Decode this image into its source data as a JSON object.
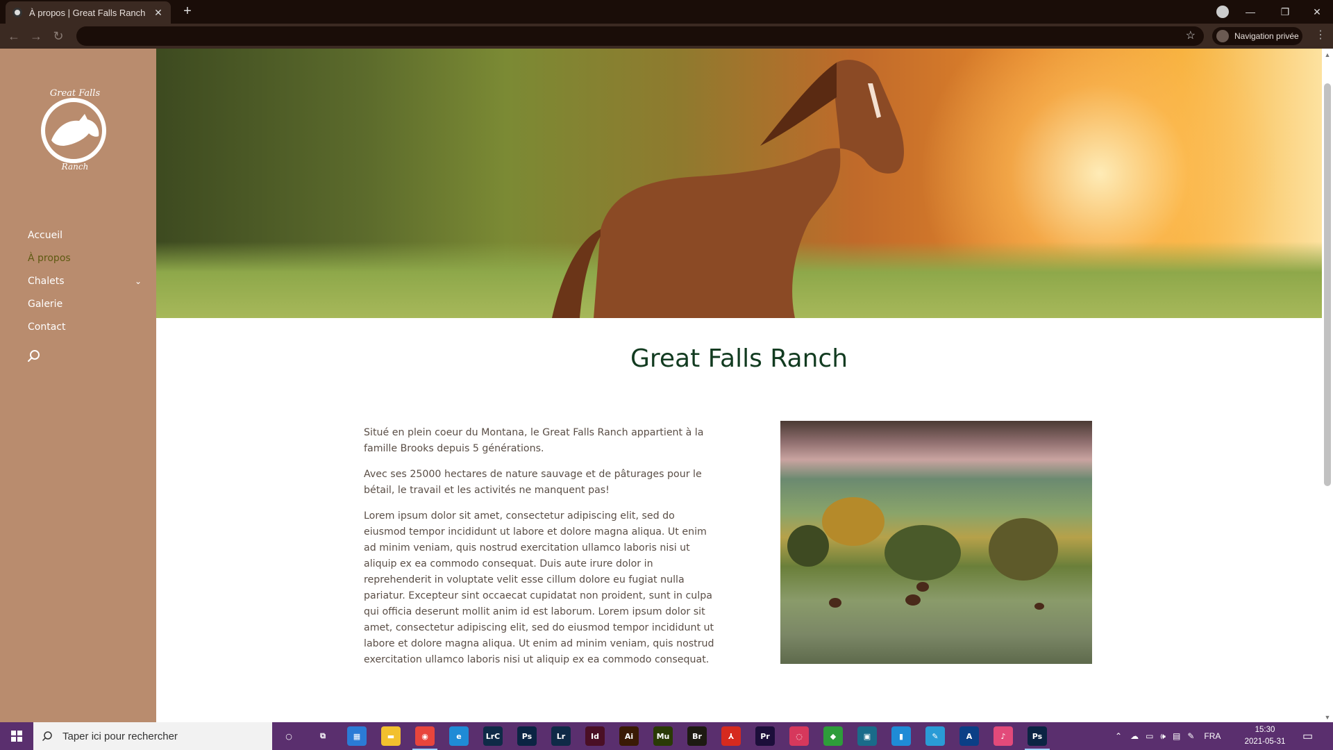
{
  "browser": {
    "tab_title": "À propos | Great Falls Ranch",
    "close_tab": "✕",
    "new_tab": "+",
    "incognito_label": "Navigation privée",
    "address": ""
  },
  "sidebar": {
    "logo_alt": "Great Falls Ranch",
    "logo_top_text": "Great Falls",
    "logo_bottom_text": "Ranch",
    "items": [
      {
        "label": "Accueil",
        "active": false
      },
      {
        "label": "À propos",
        "active": true
      },
      {
        "label": "Chalets",
        "active": false,
        "has_submenu": true
      },
      {
        "label": "Galerie",
        "active": false
      },
      {
        "label": "Contact",
        "active": false
      }
    ]
  },
  "main": {
    "title": "Great Falls Ranch",
    "paragraphs": [
      "Situé en plein coeur du Montana, le Great Falls Ranch appartient à la famille Brooks depuis 5 générations.",
      "Avec ses 25000 hectares de nature sauvage et de pâturages pour le bétail, le travail et les activités ne manquent pas!",
      "Lorem ipsum dolor sit amet, consectetur adipiscing elit, sed do eiusmod tempor incididunt ut labore et dolore magna aliqua. Ut enim ad minim veniam, quis nostrud exercitation ullamco laboris nisi ut aliquip ex ea commodo consequat. Duis aute irure dolor in reprehenderit in voluptate velit esse cillum dolore eu fugiat nulla pariatur. Excepteur sint occaecat cupidatat non proident, sunt in culpa qui officia deserunt mollit anim id est laborum. Lorem ipsum dolor sit amet, consectetur adipiscing elit, sed do eiusmod tempor incididunt ut labore et dolore magna aliqua. Ut enim ad minim veniam, quis nostrud exercitation ullamco laboris nisi ut aliquip ex ea commodo consequat."
    ]
  },
  "taskbar": {
    "search_placeholder": "Taper ici pour rechercher",
    "apps": [
      {
        "name": "cortana-icon",
        "label": "○",
        "color": "transparent"
      },
      {
        "name": "task-view-icon",
        "label": "⧉",
        "color": "transparent"
      },
      {
        "name": "store-icon",
        "label": "▦",
        "color": "#2b7bd6"
      },
      {
        "name": "file-explorer-icon",
        "label": "▬",
        "color": "#f2c02e"
      },
      {
        "name": "chrome-icon",
        "label": "◉",
        "color": "#e8453c"
      },
      {
        "name": "edge-icon",
        "label": "e",
        "color": "#1f8bd6"
      },
      {
        "name": "lightroom-classic-icon",
        "label": "LrC",
        "color": "#0f2a47"
      },
      {
        "name": "photoshop-icon",
        "label": "Ps",
        "color": "#0b2443"
      },
      {
        "name": "lightroom-icon",
        "label": "Lr",
        "color": "#0f2a47"
      },
      {
        "name": "indesign-icon",
        "label": "Id",
        "color": "#4a0f25"
      },
      {
        "name": "illustrator-icon",
        "label": "Ai",
        "color": "#3a1a05"
      },
      {
        "name": "muse-icon",
        "label": "Mu",
        "color": "#2a3a06"
      },
      {
        "name": "bridge-icon",
        "label": "Br",
        "color": "#1d1a12"
      },
      {
        "name": "acrobat-icon",
        "label": "⅄",
        "color": "#d62a1e"
      },
      {
        "name": "premiere-icon",
        "label": "Pr",
        "color": "#1c0e3a"
      },
      {
        "name": "creative-cloud-icon",
        "label": "◌",
        "color": "#d6385c"
      },
      {
        "name": "maps-icon",
        "label": "◆",
        "color": "#2e9c3a"
      },
      {
        "name": "capture-icon",
        "label": "▣",
        "color": "#1a6b8a"
      },
      {
        "name": "notes-icon",
        "label": "▮",
        "color": "#1f8bd6"
      },
      {
        "name": "sketch-icon",
        "label": "✎",
        "color": "#2a9bd6"
      },
      {
        "name": "fonts-icon",
        "label": "A",
        "color": "#0b3f86"
      },
      {
        "name": "itunes-icon",
        "label": "♪",
        "color": "#e24a7a"
      },
      {
        "name": "photoshop-active-icon",
        "label": "Ps",
        "color": "#0b2443"
      }
    ],
    "language": "FRA",
    "time": "15:30",
    "date": "2021-05-31"
  }
}
